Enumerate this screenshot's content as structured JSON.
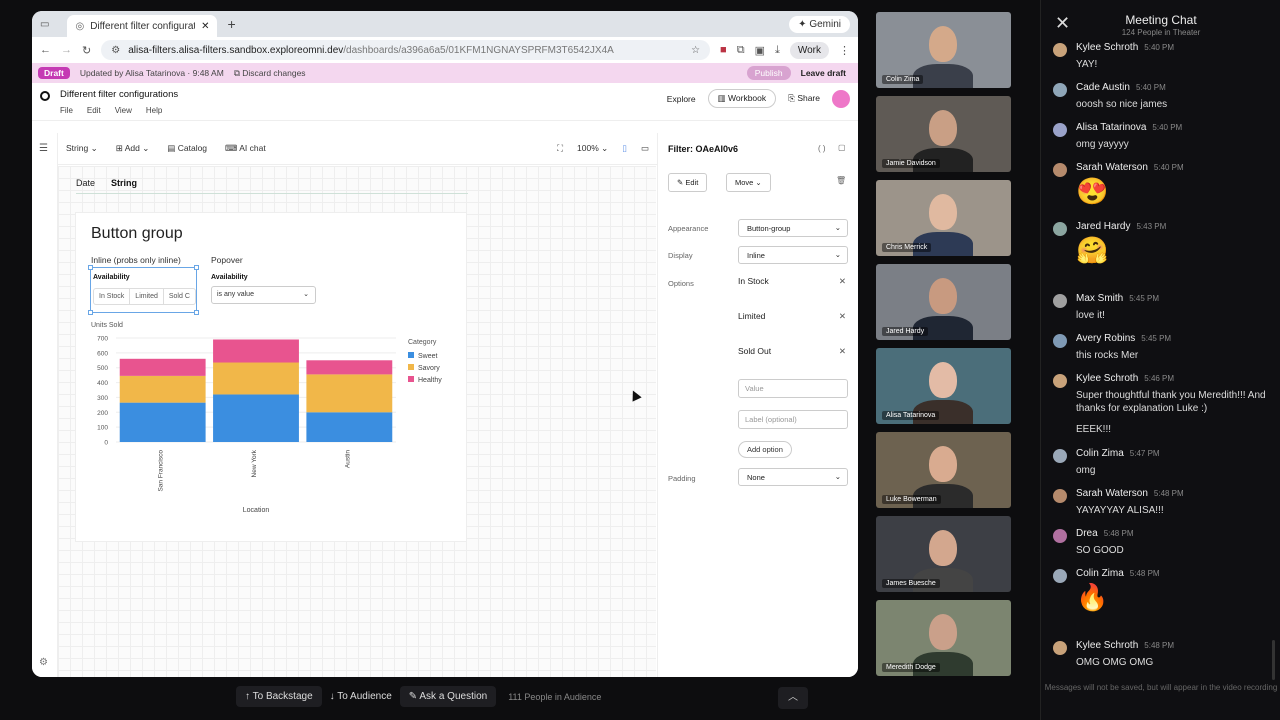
{
  "browser": {
    "tab_title": "Different filter configurations",
    "gemini_label": "Gemini",
    "url_host": "alisa-filters.alisa-filters.sandbox.exploreomni.dev",
    "url_path": "/dashboards/a396a6a5/01KFM1NGNAYSPRFM3T6542JX4A",
    "profile_label": "Work"
  },
  "draftbar": {
    "badge": "Draft",
    "updated_by": "Updated by Alisa Tatarinova · 9:48 AM",
    "discard": "Discard changes",
    "publish": "Publish",
    "leave": "Leave draft"
  },
  "app": {
    "doc_title": "Different filter configurations",
    "menus": [
      "File",
      "Edit",
      "View",
      "Help"
    ],
    "explore": "Explore",
    "workbook": "Workbook",
    "share": "Share"
  },
  "toolbar": {
    "type": "String",
    "add": "Add",
    "catalog": "Catalog",
    "ai_chat": "AI chat",
    "zoom": "100%"
  },
  "canvas": {
    "tabs": [
      "Date",
      "String"
    ],
    "card_title": "Button group",
    "inline_label": "Inline (probs only inline)",
    "popover_label": "Popover",
    "availability": "Availability",
    "buttons": [
      "In Stock",
      "Limited",
      "Sold C"
    ],
    "popover_value": "is any value"
  },
  "chart_data": {
    "type": "bar",
    "stacked": true,
    "title": "Units Sold",
    "xlabel": "Location",
    "ylabel": "",
    "categories": [
      "San Francisco",
      "New York",
      "Austin"
    ],
    "series": [
      {
        "name": "Sweet",
        "color": "#3b8ee0",
        "values": [
          265,
          320,
          200
        ]
      },
      {
        "name": "Savory",
        "color": "#f1b749",
        "values": [
          180,
          215,
          255
        ]
      },
      {
        "name": "Healthy",
        "color": "#e8548f",
        "values": [
          115,
          155,
          95
        ]
      }
    ],
    "yticks": [
      0,
      100,
      200,
      300,
      400,
      500,
      600,
      700
    ],
    "ylim": [
      0,
      700
    ],
    "legend_title": "Category",
    "legend_position": "right"
  },
  "panel": {
    "title": "Filter: OAeAI0v6",
    "edit": "Edit",
    "move": "Move",
    "appearance_label": "Appearance",
    "appearance_value": "Button-group",
    "display_label": "Display",
    "display_value": "Inline",
    "options_label": "Options",
    "options": [
      "In Stock",
      "Limited",
      "Sold Out"
    ],
    "value_placeholder": "Value",
    "label_placeholder": "Label (optional)",
    "add_option": "Add option",
    "padding_label": "Padding",
    "padding_value": "None"
  },
  "bottombar": {
    "backstage": "To Backstage",
    "audience": "To Audience",
    "ask": "Ask a Question",
    "audience_count": "111 People in Audience"
  },
  "tiles": [
    {
      "name": "Colin Zima"
    },
    {
      "name": "Jamie Davidson"
    },
    {
      "name": "Chris Merrick"
    },
    {
      "name": "Jared Hardy"
    },
    {
      "name": "Alisa Tatarinova"
    },
    {
      "name": "Luke Bowerman"
    },
    {
      "name": "James Buesche"
    },
    {
      "name": "Meredith Dodge"
    }
  ],
  "chat": {
    "title": "Meeting Chat",
    "subtitle": "124 People in Theater",
    "footer": "Messages will not be saved, but will appear in the video recording",
    "messages": [
      {
        "name": "Kylee Schroth",
        "time": "5:40 PM",
        "text": "YAY!"
      },
      {
        "name": "Cade Austin",
        "time": "5:40 PM",
        "text": "ooosh so nice james"
      },
      {
        "name": "Alisa Tatarinova",
        "time": "5:40 PM",
        "text": "omg yayyyy"
      },
      {
        "name": "Sarah Waterson",
        "time": "5:40 PM",
        "text": "😍"
      },
      {
        "name": "Jared Hardy",
        "time": "5:43 PM",
        "text": "🤗"
      },
      {
        "name": "Max Smith",
        "time": "5:45 PM",
        "text": "love it!"
      },
      {
        "name": "Avery Robins",
        "time": "5:45 PM",
        "text": "this rocks Mer"
      },
      {
        "name": "Kylee Schroth",
        "time": "5:46 PM",
        "text": "Super thoughtful thank you Meredith!!! And thanks for explanation Luke :)"
      },
      {
        "name": "Kylee Schroth",
        "time": "",
        "text": "EEEK!!!"
      },
      {
        "name": "Colin Zima",
        "time": "5:47 PM",
        "text": "omg"
      },
      {
        "name": "Sarah Waterson",
        "time": "5:48 PM",
        "text": "YAYAYYAY ALISA!!!"
      },
      {
        "name": "Drea",
        "time": "5:48 PM",
        "text": "SO GOOD"
      },
      {
        "name": "Colin Zima",
        "time": "5:48 PM",
        "text": "🔥"
      },
      {
        "name": "Kylee Schroth",
        "time": "5:48 PM",
        "text": "OMG OMG OMG"
      }
    ]
  }
}
